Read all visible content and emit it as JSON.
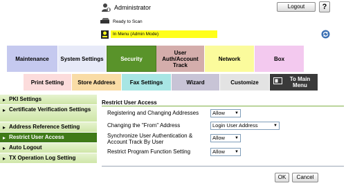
{
  "header": {
    "user_name": "Administrator",
    "logout_label": "Logout",
    "help_label": "?",
    "status_text": "Ready to Scan",
    "mode_text": "In Menu (Admin Mode)"
  },
  "tabs_row1": [
    {
      "label": "Maintenance"
    },
    {
      "label": "System Settings"
    },
    {
      "label": "Security"
    },
    {
      "label": "User Auth/Account Track"
    },
    {
      "label": "Network"
    },
    {
      "label": "Box"
    }
  ],
  "tabs_row2": [
    {
      "label": "Print Setting"
    },
    {
      "label": "Store Address"
    },
    {
      "label": "Fax Settings"
    },
    {
      "label": "Wizard"
    },
    {
      "label": "Customize"
    },
    {
      "label": "To Main Menu"
    }
  ],
  "sidebar": {
    "items": [
      {
        "label": "PKI Settings"
      },
      {
        "label": "Certificate Verification Settings"
      },
      {
        "label": "Address Reference Setting"
      },
      {
        "label": "Restrict User Access"
      },
      {
        "label": "Auto Logout"
      },
      {
        "label": "TX Operation Log Setting"
      }
    ]
  },
  "content": {
    "title": "Restrict User Access",
    "rows": [
      {
        "label": "Registering and Changing Addresses",
        "value": "Allow"
      },
      {
        "label": "Changing the \"From\" Address",
        "value": "Login User Address"
      },
      {
        "label": "Synchronize User Authentication & Account Track By User",
        "value": "Allow"
      },
      {
        "label": "Restrict Program Function Setting",
        "value": "Allow"
      }
    ],
    "ok_label": "OK",
    "cancel_label": "Cancel"
  },
  "colors": {
    "active_tab": "#59932a",
    "active_sidebar": "#3f7a18",
    "mode_bar": "#ffff1a"
  },
  "icons": {
    "user": "administrator-icon",
    "status": "scanner-icon",
    "mode": "admin-mode-icon",
    "refresh": "refresh-icon",
    "main_menu": "main-menu-icon",
    "sidebar_chevron": "chevron-right-icon"
  }
}
